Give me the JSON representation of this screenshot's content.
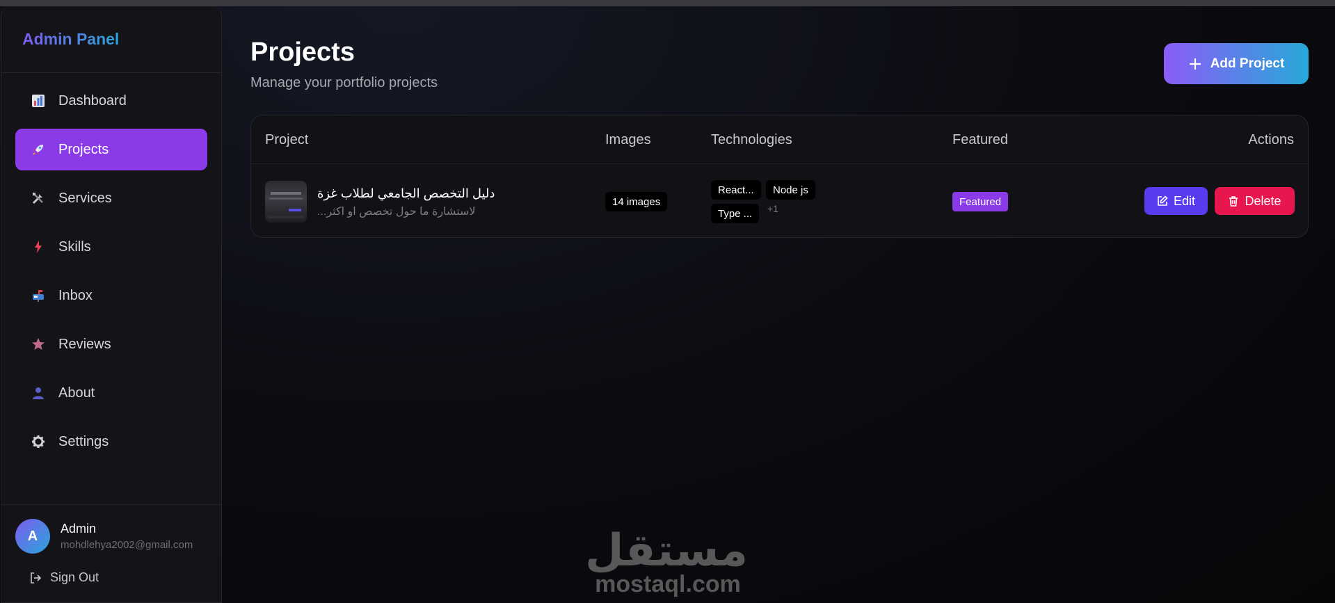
{
  "sidebar": {
    "brand": "Admin Panel",
    "items": [
      {
        "label": "Dashboard",
        "icon": "bar-chart-icon",
        "active": false
      },
      {
        "label": "Projects",
        "icon": "rocket-icon",
        "active": true
      },
      {
        "label": "Services",
        "icon": "tools-icon",
        "active": false
      },
      {
        "label": "Skills",
        "icon": "lightning-icon",
        "active": false
      },
      {
        "label": "Inbox",
        "icon": "mailbox-icon",
        "active": false
      },
      {
        "label": "Reviews",
        "icon": "star-icon",
        "active": false
      },
      {
        "label": "About",
        "icon": "person-icon",
        "active": false
      },
      {
        "label": "Settings",
        "icon": "gear-icon",
        "active": false
      }
    ],
    "user": {
      "initial": "A",
      "name": "Admin",
      "email": "mohdlehya2002@gmail.com"
    },
    "signout_label": "Sign Out"
  },
  "header": {
    "title": "Projects",
    "subtitle": "Manage your portfolio projects",
    "add_button_label": "Add Project"
  },
  "table": {
    "columns": [
      "Project",
      "Images",
      "Technologies",
      "Featured",
      "Actions"
    ],
    "rows": [
      {
        "title": "دليل التخصص الجامعي لطلاب غزة",
        "description": "لاستشارة ما حول تخصص او اكثر...",
        "images": "14 images",
        "technologies": [
          "React...",
          "Node js",
          "Type ..."
        ],
        "more_tech": "+1",
        "featured": "Featured",
        "edit_label": "Edit",
        "delete_label": "Delete"
      }
    ]
  },
  "watermark": {
    "arabic": "مستقل",
    "latin": "mostaql.com"
  },
  "colors": {
    "accent_purple": "#8b3ae8",
    "edit_blue": "#5b3bf0",
    "delete_red": "#e8164f",
    "gradient_start": "#8b5cf6",
    "gradient_end": "#27a9d9"
  }
}
